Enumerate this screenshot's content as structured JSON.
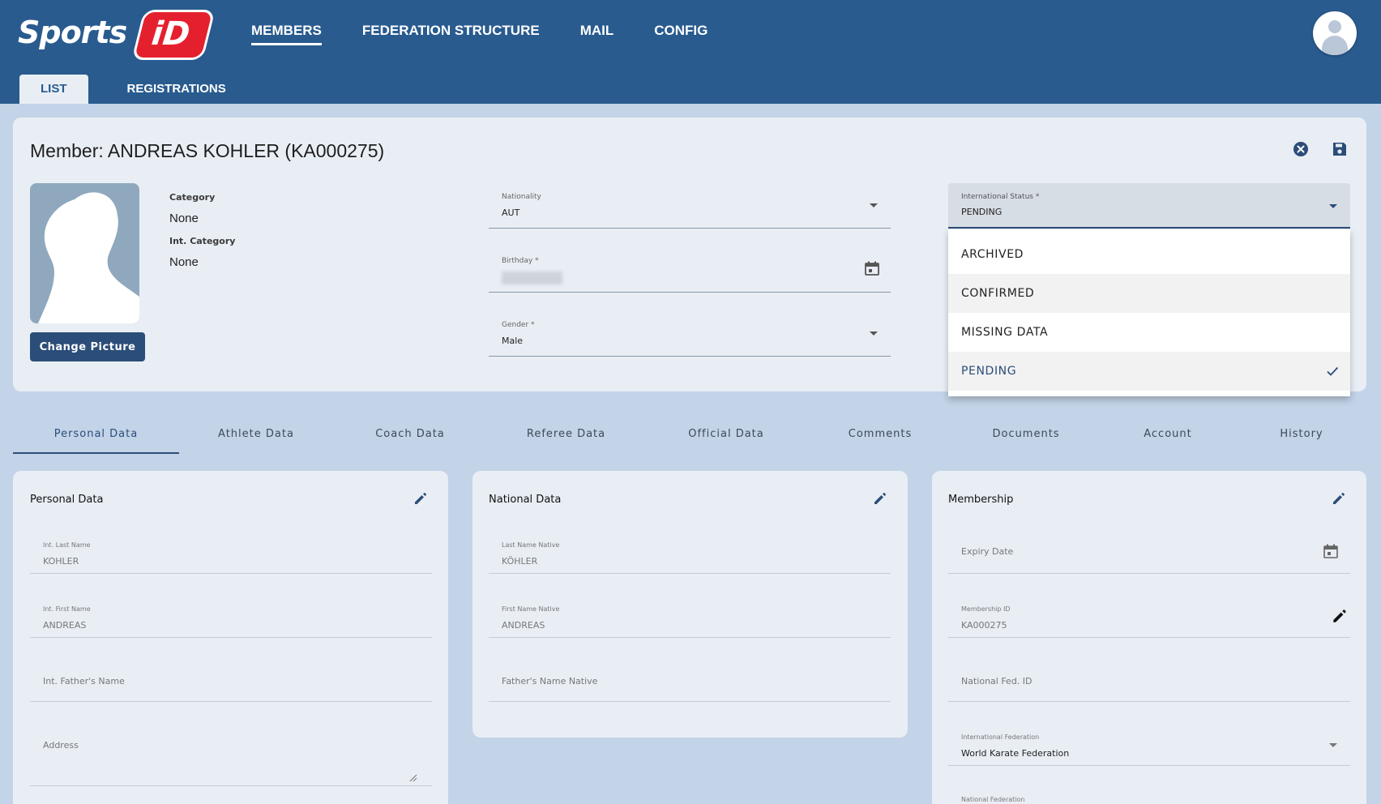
{
  "colors": {
    "header": "#295b8f",
    "accent": "#2b4d79",
    "background": "#c3d3e8",
    "card": "#e9eef5",
    "logo_red": "#e5202e"
  },
  "logo": {
    "text": "Sports",
    "badge": "iD"
  },
  "nav": [
    {
      "label": "MEMBERS"
    },
    {
      "label": "FEDERATION STRUCTURE"
    },
    {
      "label": "MAIL"
    },
    {
      "label": "CONFIG"
    }
  ],
  "subtabs": [
    {
      "label": "LIST"
    },
    {
      "label": "REGISTRATIONS"
    }
  ],
  "member": {
    "title": "Member: ANDREAS KOHLER (KA000275)",
    "change_picture": "Change Picture",
    "category_label": "Category",
    "category_value": "None",
    "int_category_label": "Int. Category",
    "int_category_value": "None",
    "nationality_label": "Nationality",
    "nationality_value": "AUT",
    "birthday_label": "Birthday *",
    "gender_label": "Gender *",
    "gender_value": "Male",
    "int_status_label": "International Status *",
    "int_status_value": "PENDING"
  },
  "status_options": [
    {
      "label": "ARCHIVED"
    },
    {
      "label": "CONFIRMED"
    },
    {
      "label": "MISSING DATA"
    },
    {
      "label": "PENDING",
      "selected": true
    }
  ],
  "section_tabs": [
    {
      "label": "Personal Data"
    },
    {
      "label": "Athlete Data"
    },
    {
      "label": "Coach Data"
    },
    {
      "label": "Referee Data"
    },
    {
      "label": "Official Data"
    },
    {
      "label": "Comments"
    },
    {
      "label": "Documents"
    },
    {
      "label": "Account"
    },
    {
      "label": "History"
    }
  ],
  "personal": {
    "title": "Personal Data",
    "last_name_label": "Int. Last Name",
    "last_name_value": "KOHLER",
    "first_name_label": "Int. First Name",
    "first_name_value": "ANDREAS",
    "father_placeholder": "Int. Father's Name",
    "address_placeholder": "Address"
  },
  "national": {
    "title": "National Data",
    "last_name_label": "Last Name Native",
    "last_name_value": "KÖHLER",
    "first_name_label": "First Name Native",
    "first_name_value": "ANDREAS",
    "father_placeholder": "Father's Name Native"
  },
  "membership": {
    "title": "Membership",
    "expiry_placeholder": "Expiry Date",
    "id_label": "Membership ID",
    "id_value": "KA000275",
    "nat_fed_id_placeholder": "National Fed. ID",
    "int_fed_label": "International Federation",
    "int_fed_value": "World Karate Federation",
    "nat_fed_label": "National Federation"
  }
}
